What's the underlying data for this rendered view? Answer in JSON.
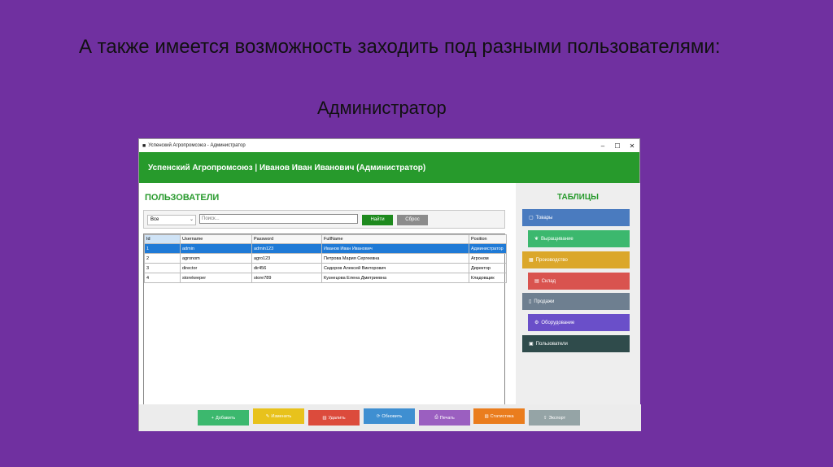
{
  "slide": {
    "title": "А также имеется возможность заходить под разными пользователями:",
    "subtitle": "Администратор"
  },
  "window": {
    "title": "Успенский Агропромсоюз - Администратор",
    "header": "Успенский Агропромсоюз | Иванов Иван Иванович (Администратор)"
  },
  "users": {
    "section_title": "ПОЛЬЗОВАТЕЛИ",
    "filter_value": "Все",
    "search_placeholder": "Поиск...",
    "find_label": "Найти",
    "reset_label": "Сброс",
    "columns": [
      "Id",
      "Username",
      "Password",
      "FullName",
      "Position"
    ],
    "rows": [
      [
        "1",
        "admin",
        "admin123",
        "Иванов Иван Иванович",
        "Администратор"
      ],
      [
        "2",
        "agronom",
        "agro123",
        "Петрова Мария Сергеевна",
        "Агроном"
      ],
      [
        "3",
        "director",
        "dir456",
        "Сидоров Алексей Викторович",
        "Директор"
      ],
      [
        "4",
        "storekeeper",
        "store789",
        "Кузнецова Елена Дмитриевна",
        "Кладовщик"
      ]
    ]
  },
  "tables_panel": {
    "title": "ТАБЛИЦЫ",
    "items": [
      {
        "label": "Товары",
        "color": "#4a7bbf"
      },
      {
        "label": "Выращивание",
        "color": "#3cb86e"
      },
      {
        "label": "Производство",
        "color": "#dba72a"
      },
      {
        "label": "Склад",
        "color": "#d9534f"
      },
      {
        "label": "Продажи",
        "color": "#6e7f90"
      },
      {
        "label": "Оборудование",
        "color": "#6a4fc9"
      },
      {
        "label": "Пользователи",
        "color": "#2f4b4b"
      }
    ]
  },
  "actions": [
    {
      "label": "Добавить",
      "color": "#3cb86e"
    },
    {
      "label": "Изменить",
      "color": "#e8c21c"
    },
    {
      "label": "Удалить",
      "color": "#dc4b3c"
    },
    {
      "label": "Обновить",
      "color": "#3f8fd1"
    },
    {
      "label": "Печать",
      "color": "#9b5fc0"
    },
    {
      "label": "Статистика",
      "color": "#ea7d1e"
    },
    {
      "label": "Экспорт",
      "color": "#95a4a6"
    }
  ]
}
